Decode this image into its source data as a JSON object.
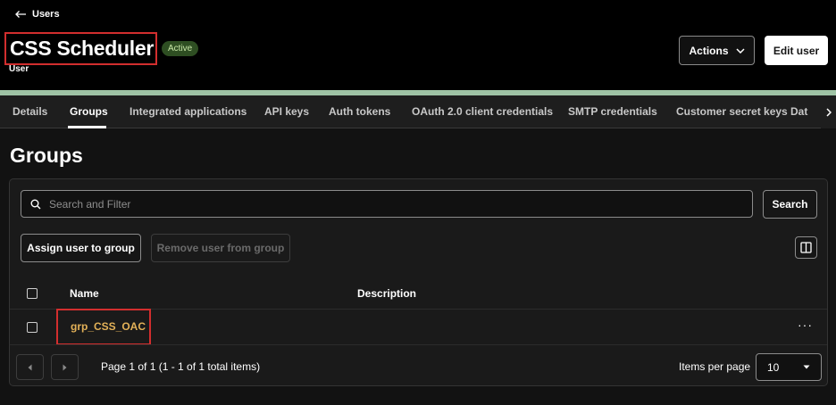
{
  "header": {
    "back_label": "Users",
    "title": "CSS Scheduler",
    "status": "Active",
    "subtitle": "User",
    "actions_label": "Actions",
    "edit_label": "Edit user"
  },
  "tabs": [
    {
      "label": "Details",
      "active": false
    },
    {
      "label": "Groups",
      "active": true
    },
    {
      "label": "Integrated applications",
      "active": false
    },
    {
      "label": "API keys",
      "active": false
    },
    {
      "label": "Auth tokens",
      "active": false
    },
    {
      "label": "OAuth 2.0 client credentials",
      "active": false
    },
    {
      "label": "SMTP credentials",
      "active": false
    },
    {
      "label": "Customer secret keys",
      "active": false
    },
    {
      "label": "Dat",
      "active": false
    }
  ],
  "groups": {
    "heading": "Groups",
    "search": {
      "placeholder": "Search and Filter",
      "value": "",
      "button_label": "Search"
    },
    "assign_label": "Assign user to group",
    "remove_label": "Remove user from group",
    "columns": {
      "name": "Name",
      "description": "Description"
    },
    "rows": [
      {
        "name": "grp_CSS_OAC",
        "description": "",
        "menu": "···"
      }
    ],
    "pagination": {
      "page_info": "Page 1 of 1 (1 - 1 of 1 total items)",
      "items_per_page_label": "Items per page",
      "items_per_page": "10"
    }
  },
  "colors": {
    "accent_stripe": "#9fc3a5",
    "link": "#e3b158",
    "highlight_box": "#d22e2e",
    "badge_bg": "#2e4e22"
  }
}
